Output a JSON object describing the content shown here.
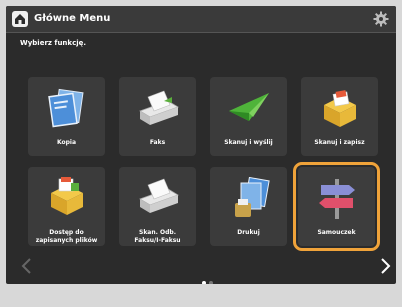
{
  "header": {
    "title": "Główne Menu",
    "home_icon": "home-icon",
    "settings_icon": "gear-icon"
  },
  "prompt": "Wybierz funkcję.",
  "tiles": [
    {
      "label": "Kopia",
      "icon": "copy-icon"
    },
    {
      "label": "Faks",
      "icon": "fax-icon"
    },
    {
      "label": "Skanuj i wyślij",
      "icon": "scan-send-icon"
    },
    {
      "label": "Skanuj i zapisz",
      "icon": "scan-save-icon"
    },
    {
      "label": "Dostęp do\nzapisanych plików",
      "icon": "stored-files-icon"
    },
    {
      "label": "Skan. Odb.\nFaksu/I-Faksu",
      "icon": "fax-receive-icon"
    },
    {
      "label": "Drukuj",
      "icon": "print-icon"
    },
    {
      "label": "Samouczek",
      "icon": "signpost-icon",
      "selected": true
    }
  ],
  "pagination": {
    "pages": 2,
    "current": 1
  },
  "colors": {
    "selection": "#f0a33a",
    "background": "#2b2b2b",
    "tile": "#3b3b3b"
  }
}
